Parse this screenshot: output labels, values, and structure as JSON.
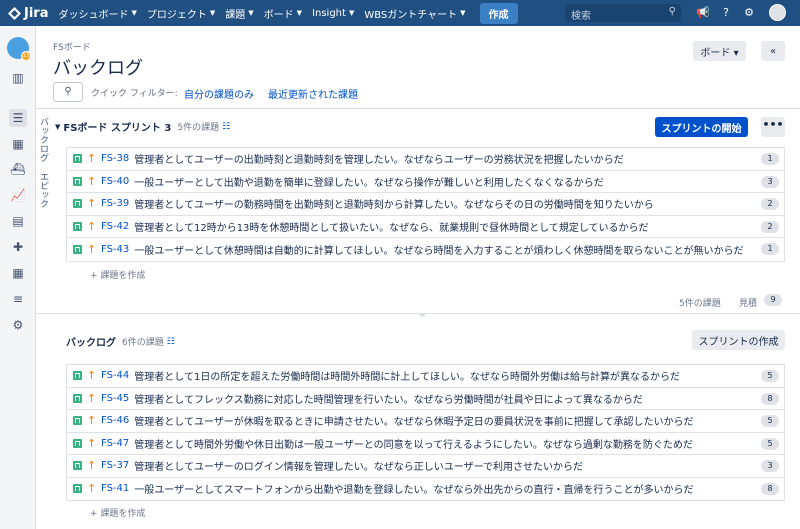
{
  "topnav": {
    "logo": "Jira",
    "items": [
      {
        "label": "ダッシュボード"
      },
      {
        "label": "プロジェクト"
      },
      {
        "label": "課題"
      },
      {
        "label": "ボード"
      },
      {
        "label": "Insight"
      },
      {
        "label": "WBSガントチャート"
      }
    ],
    "create": "作成",
    "search_placeholder": "検索"
  },
  "sidebar": {
    "project_badge": "11",
    "vertical_tabs": [
      "バックログ",
      "エピック"
    ]
  },
  "header": {
    "breadcrumb": "FSボード",
    "title": "バックログ",
    "board_button": "ボード ▾",
    "collapse_button": "«"
  },
  "quick_filters": {
    "label": "クイック フィルター:",
    "items": [
      "自分の課題のみ",
      "最近更新された課題"
    ]
  },
  "sprint": {
    "name": "FSボード スプリント 3",
    "count": "5件の課題",
    "start_button": "スプリントの開始",
    "more_button": "•••",
    "issues": [
      {
        "key": "FS-38",
        "summary": "管理者としてユーザーの出勤時刻と退勤時刻を管理したい。なぜならユーザーの労務状況を把握したいからだ",
        "estimate": "1"
      },
      {
        "key": "FS-40",
        "summary": "一般ユーザーとして出勤や退勤を簡単に登録したい。なぜなら操作が難しいと利用したくなくなるからだ",
        "estimate": "3"
      },
      {
        "key": "FS-39",
        "summary": "管理者としてユーザーの勤務時間を出勤時刻と退勤時刻から計算したい。なぜならその日の労働時間を知りたいから",
        "estimate": "2"
      },
      {
        "key": "FS-42",
        "summary": "管理者として12時から13時を休憩時間として扱いたい。なぜなら、就業規則で昼休時間として規定しているからだ",
        "estimate": "2"
      },
      {
        "key": "FS-43",
        "summary": "一般ユーザーとして休憩時間は自動的に計算してほしい。なぜなら時間を入力することが煩わしく休憩時間を取らないことが無いからだ",
        "estimate": "1"
      }
    ],
    "create_issue": "+ 課題を作成",
    "footer_count": "5件の課題",
    "footer_estimate_label": "見積",
    "footer_estimate": "9"
  },
  "backlog": {
    "name": "バックログ",
    "count": "6件の課題",
    "create_sprint_button": "スプリントの作成",
    "issues": [
      {
        "key": "FS-44",
        "summary": "管理者として1日の所定を超えた労働時間は時間外時間に計上してほしい。なぜなら時間外労働は給与計算が異なるからだ",
        "estimate": "5"
      },
      {
        "key": "FS-45",
        "summary": "管理者としてフレックス勤務に対応した時間管理を行いたい。なぜなら労働時間が社員や日によって異なるからだ",
        "estimate": "8"
      },
      {
        "key": "FS-46",
        "summary": "管理者としてユーザーが休暇を取るときに申請させたい。なぜなら休暇予定日の要員状況を事前に把握して承認したいからだ",
        "estimate": "5"
      },
      {
        "key": "FS-47",
        "summary": "管理者として時間外労働や休日出勤は一般ユーザーとの同意を以って行えるようにしたい。なぜなら過剰な勤務を防ぐためだ",
        "estimate": "5"
      },
      {
        "key": "FS-37",
        "summary": "管理者としてユーザーのログイン情報を管理したい。なぜなら正しいユーザーで利用させたいからだ",
        "estimate": "3"
      },
      {
        "key": "FS-41",
        "summary": "一般ユーザーとしてスマートフォンから出勤や退勤を登録したい。なぜなら外出先からの直行・直帰を行うことが多いからだ",
        "estimate": "8"
      }
    ],
    "create_issue": "+ 課題を作成"
  }
}
